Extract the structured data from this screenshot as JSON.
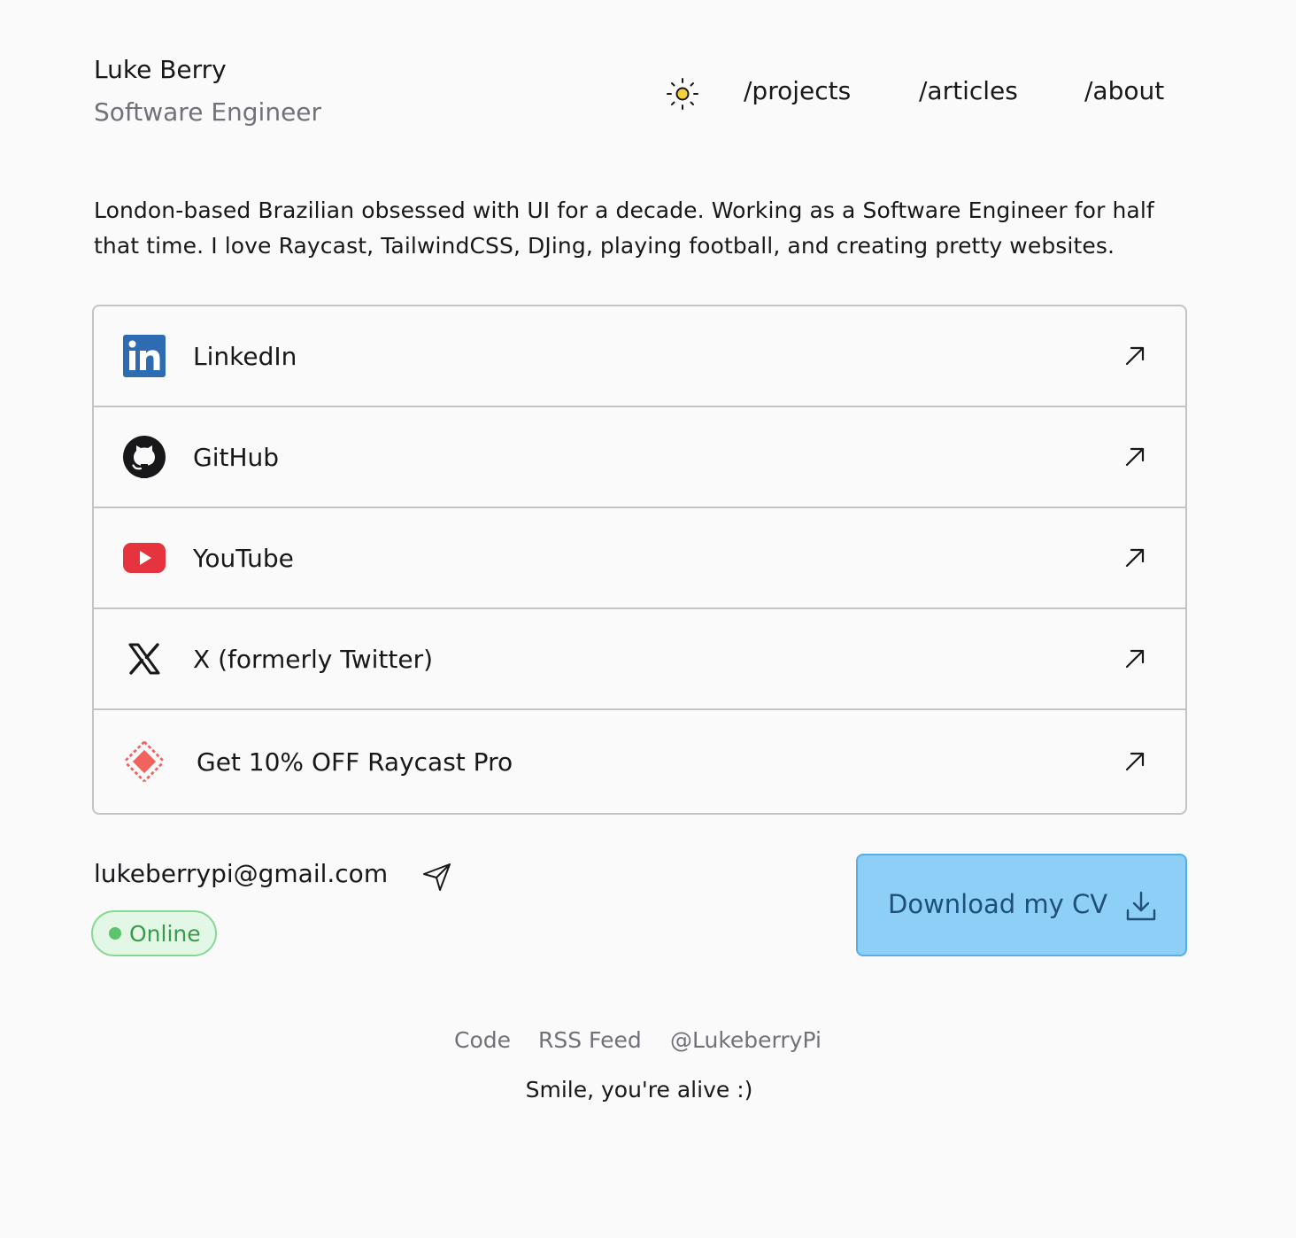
{
  "header": {
    "name": "Luke Berry",
    "role": "Software Engineer",
    "theme_icon": "sun-icon",
    "nav": {
      "projects": "/projects",
      "articles": "/articles",
      "about": "/about"
    }
  },
  "bio": "London-based Brazilian obsessed with UI for a decade. Working as a Software Engineer for half that time. I love Raycast, TailwindCSS, DJing, playing football, and creating pretty websites.",
  "links": [
    {
      "label": "LinkedIn",
      "icon": "linkedin-icon"
    },
    {
      "label": "GitHub",
      "icon": "github-icon"
    },
    {
      "label": "YouTube",
      "icon": "youtube-icon"
    },
    {
      "label": "X (formerly Twitter)",
      "icon": "x-icon"
    },
    {
      "label": "Get 10% OFF Raycast Pro",
      "icon": "raycast-icon"
    }
  ],
  "contact": {
    "email": "lukeberrypi@gmail.com",
    "status": "Online"
  },
  "cv_button": {
    "label": "Download my CV"
  },
  "footer": {
    "code": "Code",
    "rss": "RSS Feed",
    "handle": "@LukeberryPi",
    "tagline": "Smile, you're alive :)"
  },
  "colors": {
    "background": "#fafafa",
    "text": "#18181b",
    "muted": "#71717a",
    "border": "#c4c4c8",
    "linkedin": "#2d6bb3",
    "youtube": "#e5343d",
    "raycast": "#f2625f",
    "online_green": "#5cc46c",
    "cv_button_bg": "#8ecff7",
    "cv_button_text": "#1d4f7a"
  }
}
